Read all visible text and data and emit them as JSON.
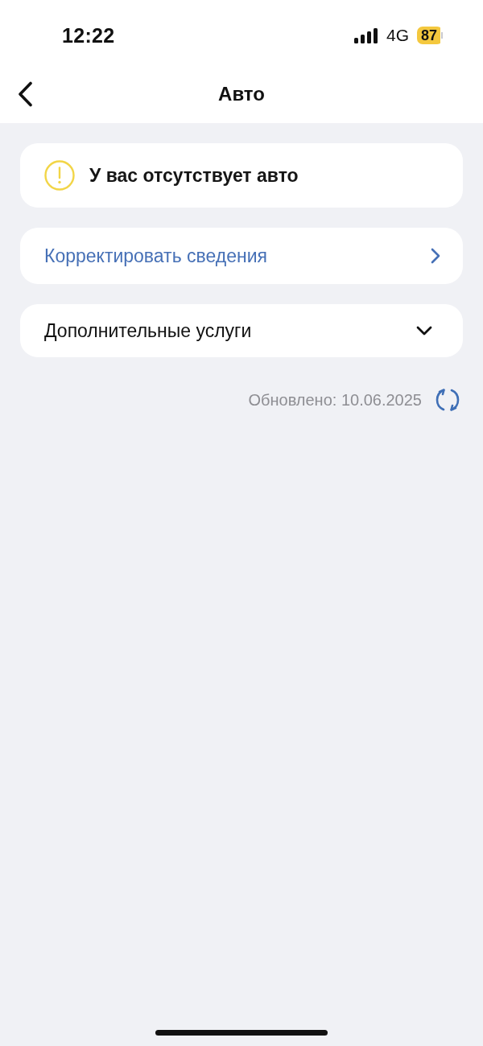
{
  "status_bar": {
    "time": "12:22",
    "network": "4G",
    "battery": "87",
    "low_power": true
  },
  "nav_bar": {
    "title": "Авто"
  },
  "notice": {
    "text": "У вас отсутствует авто"
  },
  "rows": [
    {
      "kind": "link",
      "label": "Корректировать сведения"
    },
    {
      "kind": "dropdown",
      "label": "Дополнительные услуги",
      "expanded": false
    }
  ],
  "updated": {
    "text": "Обновлено: 10.06.2025"
  }
}
